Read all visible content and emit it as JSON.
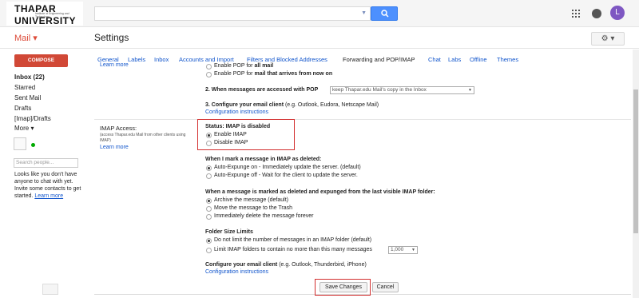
{
  "header": {
    "logo_line1": "THAPAR",
    "logo_line2": "Institute of Engineering and Technology",
    "logo_line3": "UNIVERSITY",
    "avatar_letter": "L"
  },
  "subheader": {
    "mail_label": "Mail ▾",
    "settings_title": "Settings"
  },
  "sidebar": {
    "compose": "COMPOSE",
    "items": [
      "Inbox (22)",
      "Starred",
      "Sent Mail",
      "Drafts",
      "[Imap]/Drafts",
      "More ▾"
    ],
    "search_people_placeholder": "Search people...",
    "chat_msg_1": "Looks like you don't have anyone to chat with yet. Invite some contacts to get started.",
    "chat_learn_more": "Learn more"
  },
  "tabs": [
    "General",
    "Labels",
    "Inbox",
    "Accounts and Import",
    "Filters and Blocked Addresses",
    "Forwarding and POP/IMAP",
    "Chat",
    "Labs",
    "Offline",
    "Themes"
  ],
  "pop": {
    "learn_more": "Learn more",
    "opt1_pre": "Enable POP for ",
    "opt1_b": "all mail",
    "opt2_pre": "Enable POP for ",
    "opt2_b": "mail that arrives from now on",
    "step2": "2. When messages are accessed with POP",
    "step2_select": "keep Thapar.edu Mail's copy in the Inbox",
    "step3_b": "3. Configure your email client",
    "step3_rest": " (e.g. Outlook, Eudora, Netscape Mail)",
    "config_link": "Configuration instructions"
  },
  "imap": {
    "label": "IMAP Access:",
    "sublabel1": "(access Thapar.edu Mail from other clients using",
    "sublabel2": "IMAP)",
    "learn_more": "Learn more",
    "status": "Status: IMAP is disabled",
    "enable": "Enable IMAP",
    "disable": "Disable IMAP",
    "deleted_heading": "When I mark a message in IMAP as deleted:",
    "auto_on": "Auto-Expunge on - Immediately update the server. (default)",
    "auto_off": "Auto-Expunge off - Wait for the client to update the server.",
    "expunged_heading": "When a message is marked as deleted and expunged from the last visible IMAP folder:",
    "archive": "Archive the message (default)",
    "trash": "Move the message to the Trash",
    "delete": "Immediately delete the message forever",
    "folder_heading": "Folder Size Limits",
    "no_limit": "Do not limit the number of messages in an IMAP folder (default)",
    "limit": "Limit IMAP folders to contain no more than this many messages",
    "limit_value": "1,000",
    "client_b": "Configure your email client",
    "client_rest": " (e.g. Outlook, Thunderbird, iPhone)",
    "config_link": "Configuration instructions"
  },
  "footer": {
    "save": "Save Changes",
    "cancel": "Cancel"
  }
}
